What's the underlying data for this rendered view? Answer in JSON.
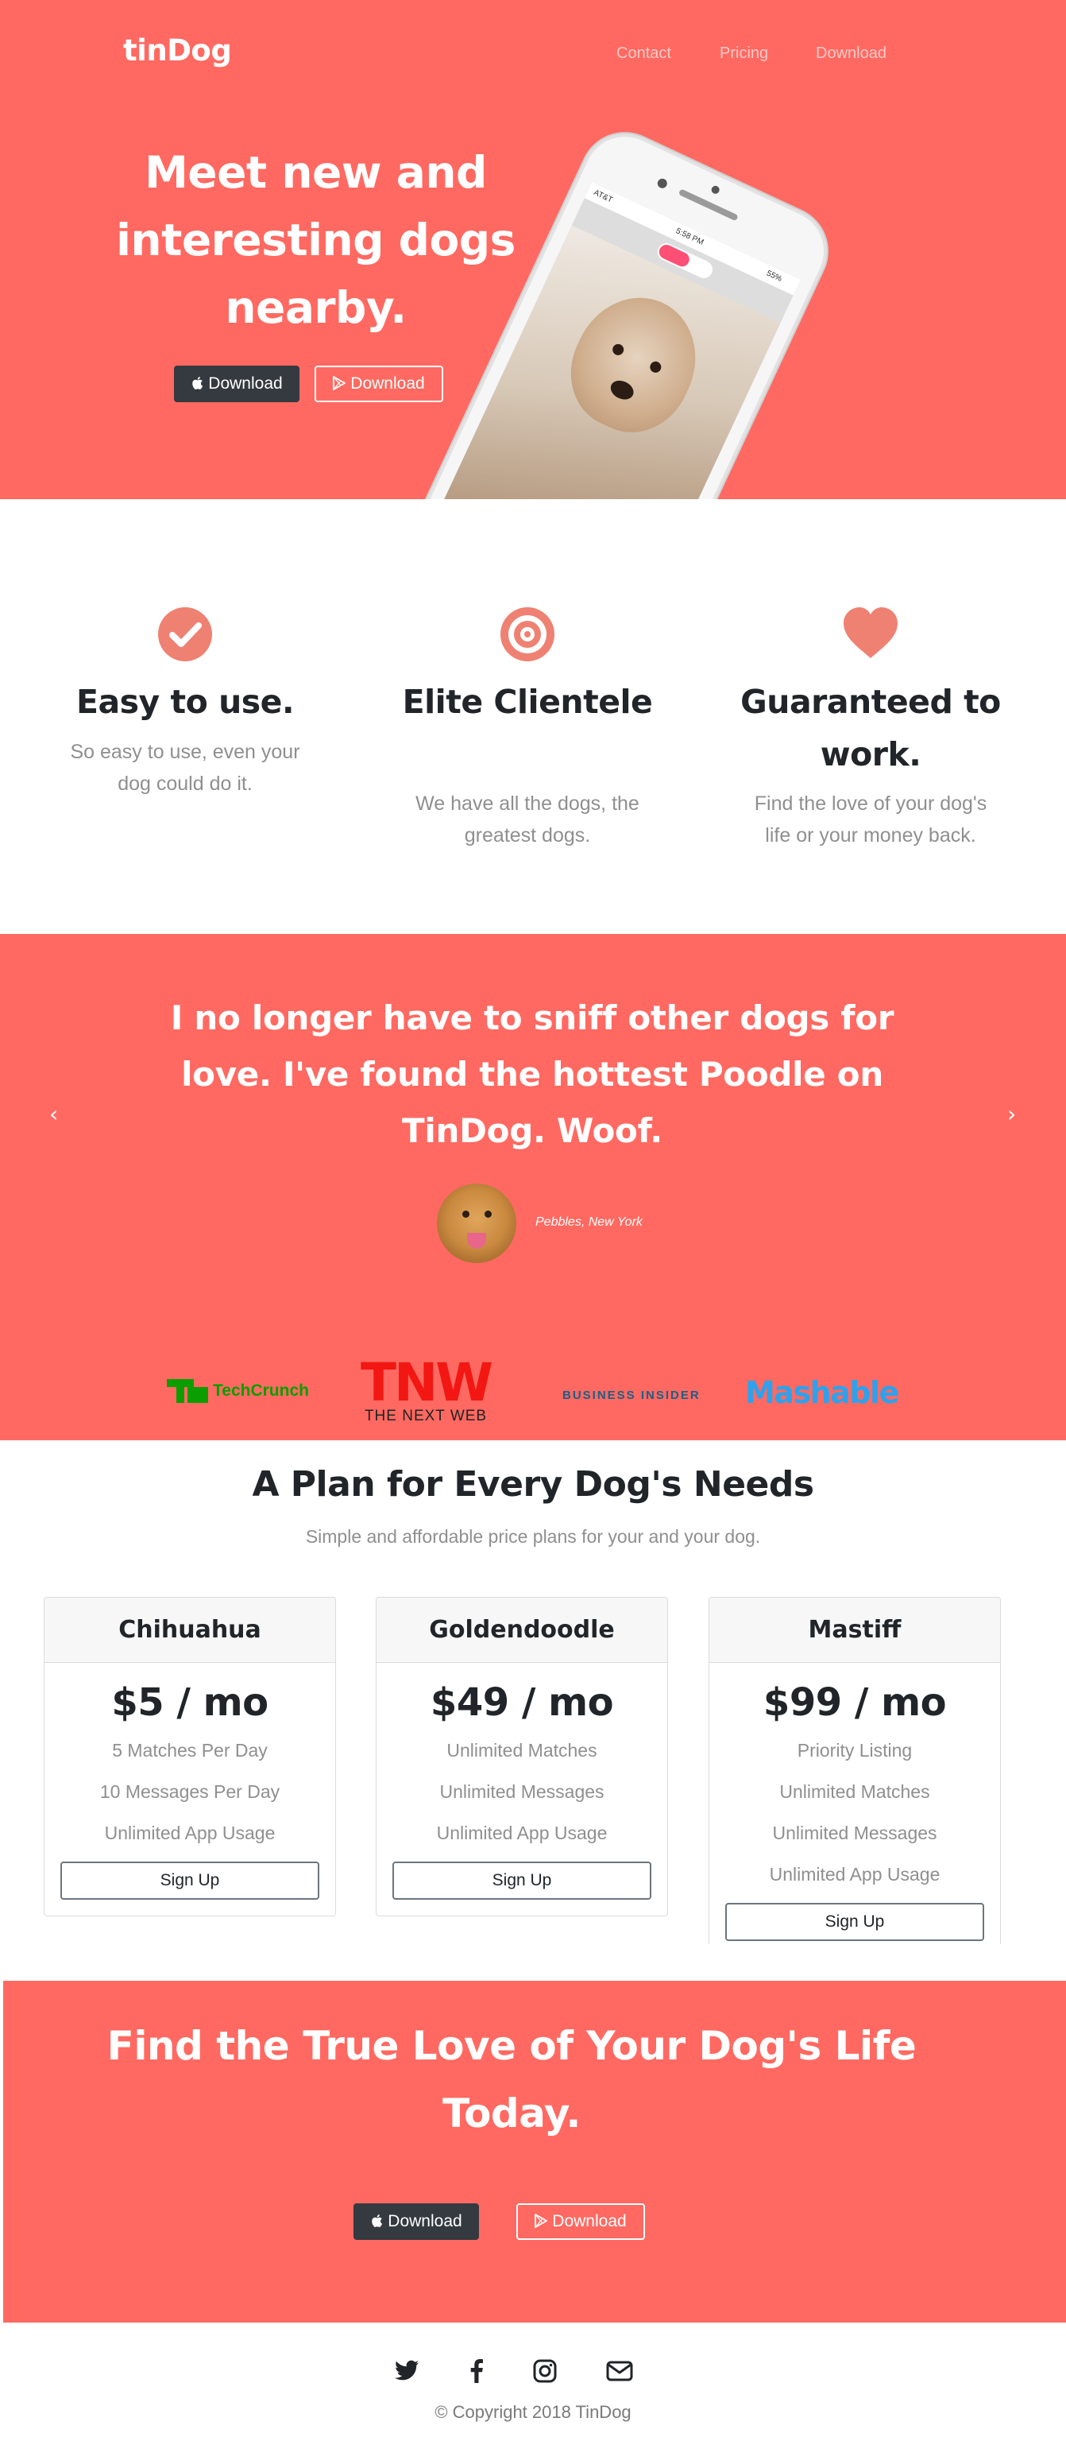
{
  "nav": {
    "brand": "tinDog",
    "links": [
      "Contact",
      "Pricing",
      "Download"
    ]
  },
  "hero": {
    "title": "Meet new and interesting dogs nearby.",
    "download_apple": "Download",
    "download_google": "Download",
    "phone": {
      "carrier": "AT&T",
      "time": "5:58 PM",
      "battery": "55%"
    }
  },
  "features": [
    {
      "icon": "check-circle-icon",
      "title": "Easy to use.",
      "text": "So easy to use, even your dog could do it."
    },
    {
      "icon": "bullseye-icon",
      "title": "Elite Clientele",
      "text": "We have all the dogs, the greatest dogs."
    },
    {
      "icon": "heart-icon",
      "title": "Guaranteed to work.",
      "text": "Find the love of your dog's life or your money back."
    }
  ],
  "testimonial": {
    "quote": "I no longer have to sniff other dogs for love. I've found the hottest Poodle on TinDog. Woof.",
    "author": "Pebbles, New York"
  },
  "press": {
    "techcrunch": "TechCrunch",
    "tnw": "TNW",
    "tnw_sub": "THE NEXT WEB",
    "business_insider": "BUSINESS INSIDER",
    "mashable": "Mashable"
  },
  "pricing": {
    "title": "A Plan for Every Dog's Needs",
    "subtitle": "Simple and affordable price plans for your and your dog.",
    "plans": [
      {
        "name": "Chihuahua",
        "price": "$5 / mo",
        "features": [
          "5 Matches Per Day",
          "10 Messages Per Day",
          "Unlimited App Usage"
        ],
        "button": "Sign Up"
      },
      {
        "name": "Goldendoodle",
        "price": "$49 / mo",
        "features": [
          "Unlimited Matches",
          "Unlimited Messages",
          "Unlimited App Usage"
        ],
        "button": "Sign Up"
      },
      {
        "name": "Mastiff",
        "price": "$99 / mo",
        "features": [
          "Priority Listing",
          "Unlimited Matches",
          "Unlimited Messages",
          "Unlimited App Usage"
        ],
        "button": "Sign Up"
      }
    ]
  },
  "cta": {
    "title": "Find the True Love of Your Dog's Life Today.",
    "download_apple": "Download",
    "download_google": "Download"
  },
  "footer": {
    "icons": [
      "twitter-icon",
      "facebook-icon",
      "instagram-icon",
      "envelope-icon"
    ],
    "copyright": "© Copyright 2018 TinDog"
  },
  "colors": {
    "brand": "#ff6961",
    "dark": "#343a40",
    "muted": "#8f8f8f"
  }
}
